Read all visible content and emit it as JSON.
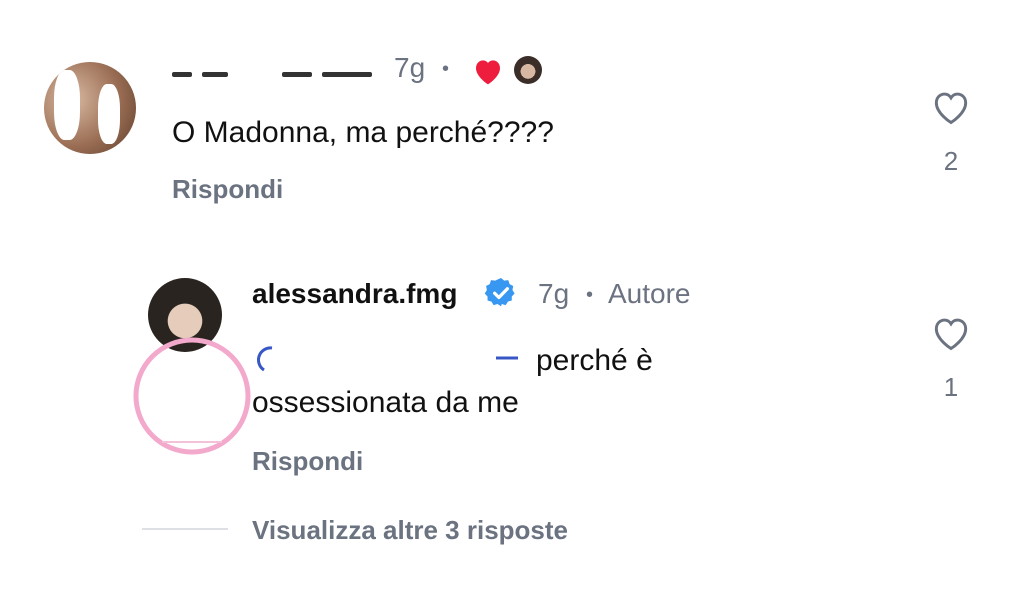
{
  "comment1": {
    "time": "7g",
    "text": "O Madonna, ma perché????",
    "reply_label": "Rispondi",
    "like_count": "2",
    "liked_by_author_color": "#ee1d3e"
  },
  "comment2": {
    "username": "alessandra.fmg",
    "verified_icon": "verified-badge-icon",
    "time": "7g",
    "author_label": "Autore",
    "text_line1": "perché è",
    "text_line2": "ossessionata da me",
    "reply_label": "Rispondi",
    "like_count": "1"
  },
  "view_more": {
    "label": "Visualizza altre 3 risposte"
  },
  "colors": {
    "accent_blue": "#3897f0",
    "muted_text": "#6b7280",
    "heart_red": "#ee1d3e"
  }
}
